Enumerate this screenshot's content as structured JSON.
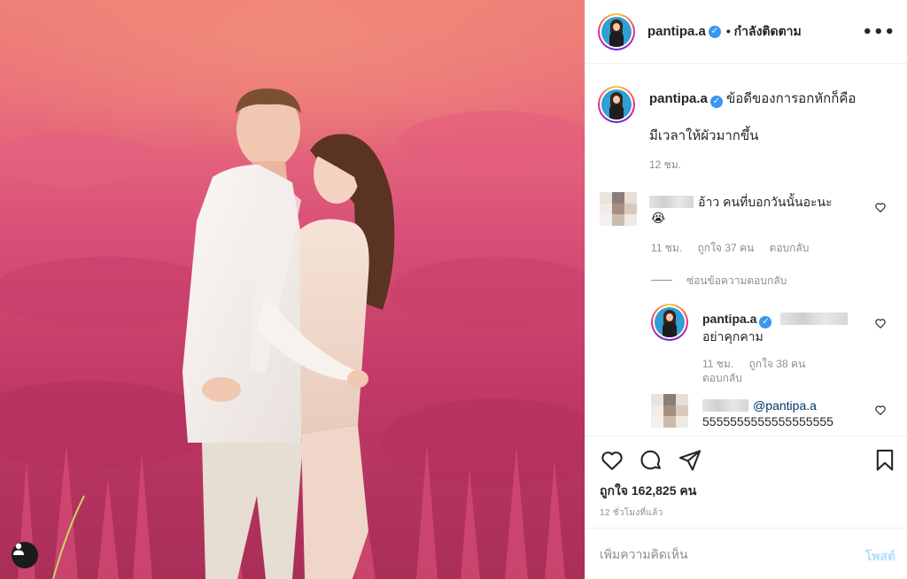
{
  "post": {
    "username": "pantipa.a",
    "follow_status": "• กำลังติดตาม",
    "more_label": "•••"
  },
  "caption": {
    "username": "pantipa.a",
    "line1": "ข้อดีของการอกหักก็คือ",
    "line2": "มีเวลาให้ผัวมากขึ้น",
    "time": "12 ชม."
  },
  "comments": [
    {
      "text": "อ้าว คนที่บอกวันนั้นอะนะ",
      "emoji": "😭",
      "time": "11 ชม.",
      "likes": "ถูกใจ 37 คน",
      "reply_label": "ตอบกลับ",
      "hide_replies": "ซ่อนข้อความตอบกลับ"
    }
  ],
  "replies": [
    {
      "username": "pantipa.a",
      "text": "อย่าคุกคาม",
      "time": "11 ชม.",
      "likes": "ถูกใจ 38 คน",
      "reply_label": "ตอบกลับ"
    },
    {
      "mention": "@pantipa.a",
      "text": "5555555555555555555"
    }
  ],
  "actions": {
    "likes_text": "ถูกใจ 162,825 คน",
    "time_ago": "12 ชั่วโมงที่แล้ว"
  },
  "composer": {
    "placeholder": "เพิ่มความคิดเห็น",
    "post_label": "โพสต์"
  },
  "colors": {
    "accent_link": "#00376b",
    "verified": "#3897f0",
    "post_button_disabled": "#b2dffc"
  }
}
